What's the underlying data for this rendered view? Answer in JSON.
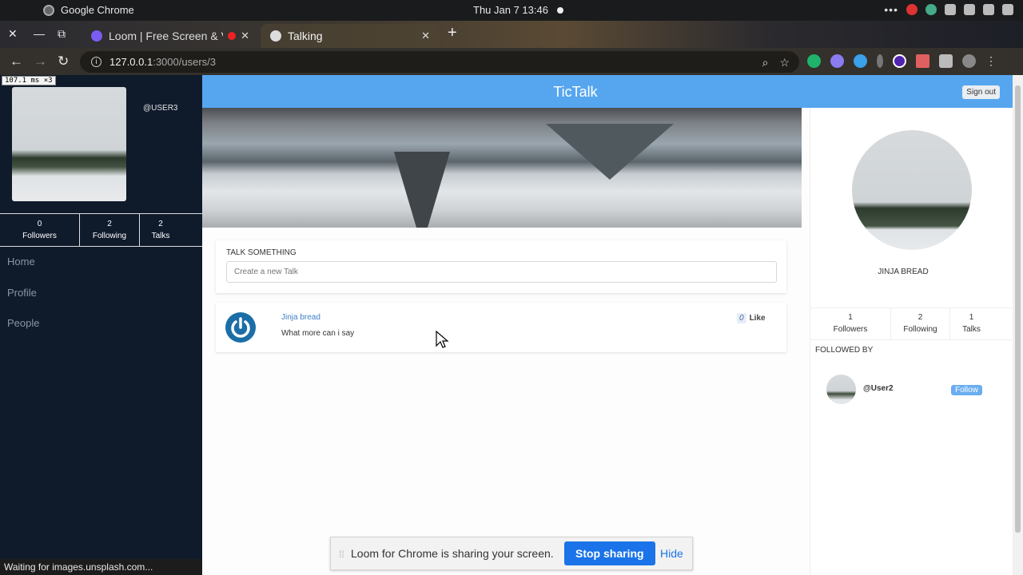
{
  "os": {
    "app_name": "Google Chrome",
    "clock": "Thu Jan 7  13:46",
    "tray_dots": "•••"
  },
  "browser": {
    "tabs": [
      {
        "title": "Loom | Free Screen & Video Recording",
        "active": false,
        "close": "✕"
      },
      {
        "title": "Talking",
        "active": true,
        "close": "✕"
      }
    ],
    "new_tab": "+",
    "url_host": "127.0.0.1",
    "url_path": ":3000/users/3",
    "status_text": "Waiting for images.unsplash.com..."
  },
  "perf_badge": "107.1 ms ×3",
  "sidebar": {
    "handle": "@USER3",
    "stats": [
      {
        "num": "0",
        "label": "Followers"
      },
      {
        "num": "2",
        "label": "Following"
      },
      {
        "num": "2",
        "label": "Talks"
      }
    ],
    "nav": [
      "Home",
      "Profile",
      "People"
    ]
  },
  "header": {
    "title": "TicTalk",
    "signout": "Sign out"
  },
  "talk_form": {
    "label": "TALK SOMETHING",
    "placeholder": "Create a new Talk"
  },
  "post": {
    "author": "Jinja bread",
    "text": "What more can i say",
    "like_count": "0",
    "like_label": "Like"
  },
  "profile": {
    "name": "JINJA BREAD",
    "stats": [
      {
        "num": "1",
        "label": "Followers"
      },
      {
        "num": "2",
        "label": "Following"
      },
      {
        "num": "1",
        "label": "Talks"
      }
    ],
    "followed_by_label": "FOLLOWED BY",
    "followers": [
      {
        "handle": "@User2",
        "button": "Follow"
      }
    ]
  },
  "loom": {
    "message": "Loom for Chrome is sharing your screen.",
    "stop": "Stop sharing",
    "hide": "Hide"
  },
  "colors": {
    "header": "#56a6ef",
    "sidebar": "#0f1a2b",
    "accent": "#1a73e8"
  }
}
